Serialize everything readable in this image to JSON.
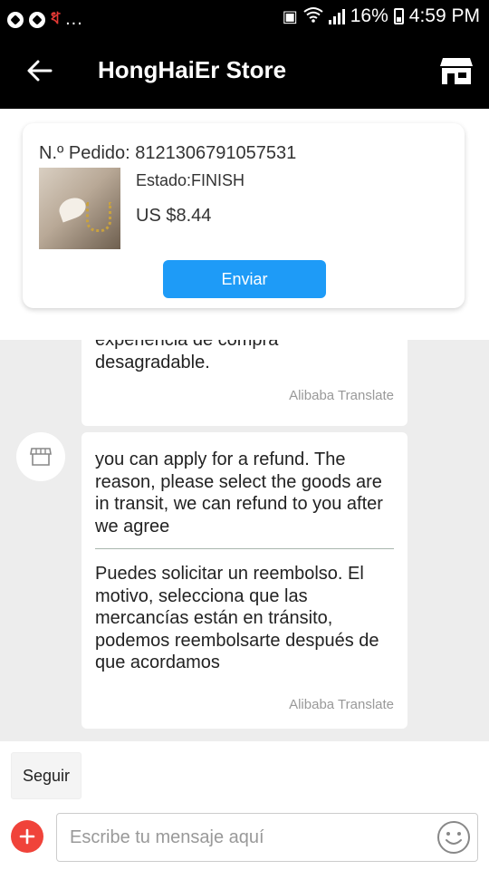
{
  "status_bar": {
    "notification_dots": "...",
    "battery_percent": "16%",
    "time": "4:59 PM"
  },
  "header": {
    "title": "HongHaiEr Store",
    "back_icon": "arrow-left-icon",
    "store_icon": "store-icon"
  },
  "order": {
    "number_label": "N.º Pedido: 8121306791057531",
    "status_label": "Estado:FINISH",
    "price_label": "US $8.44",
    "send_button": "Enviar"
  },
  "chat": {
    "messages": [
      {
        "text": "experiencia de compra desagradable.",
        "translate_label": "Alibaba Translate"
      },
      {
        "original": "you can apply for a refund. The reason, please select the goods are in transit, we can refund to you after we agree",
        "translated": "Puedes solicitar un reembolso. El motivo, selecciona que las mercancías están en tránsito, podemos reembolsarte después de que acordamos",
        "translate_label": "Alibaba Translate"
      }
    ]
  },
  "bottom": {
    "follow_button": "Seguir",
    "input_placeholder": "Escribe tu mensaje aquí",
    "input_value": ""
  },
  "colors": {
    "header_bg": "#000000",
    "accent_blue": "#1e9bf7",
    "add_button_red": "#f0433a",
    "chat_bg": "#ededed"
  }
}
